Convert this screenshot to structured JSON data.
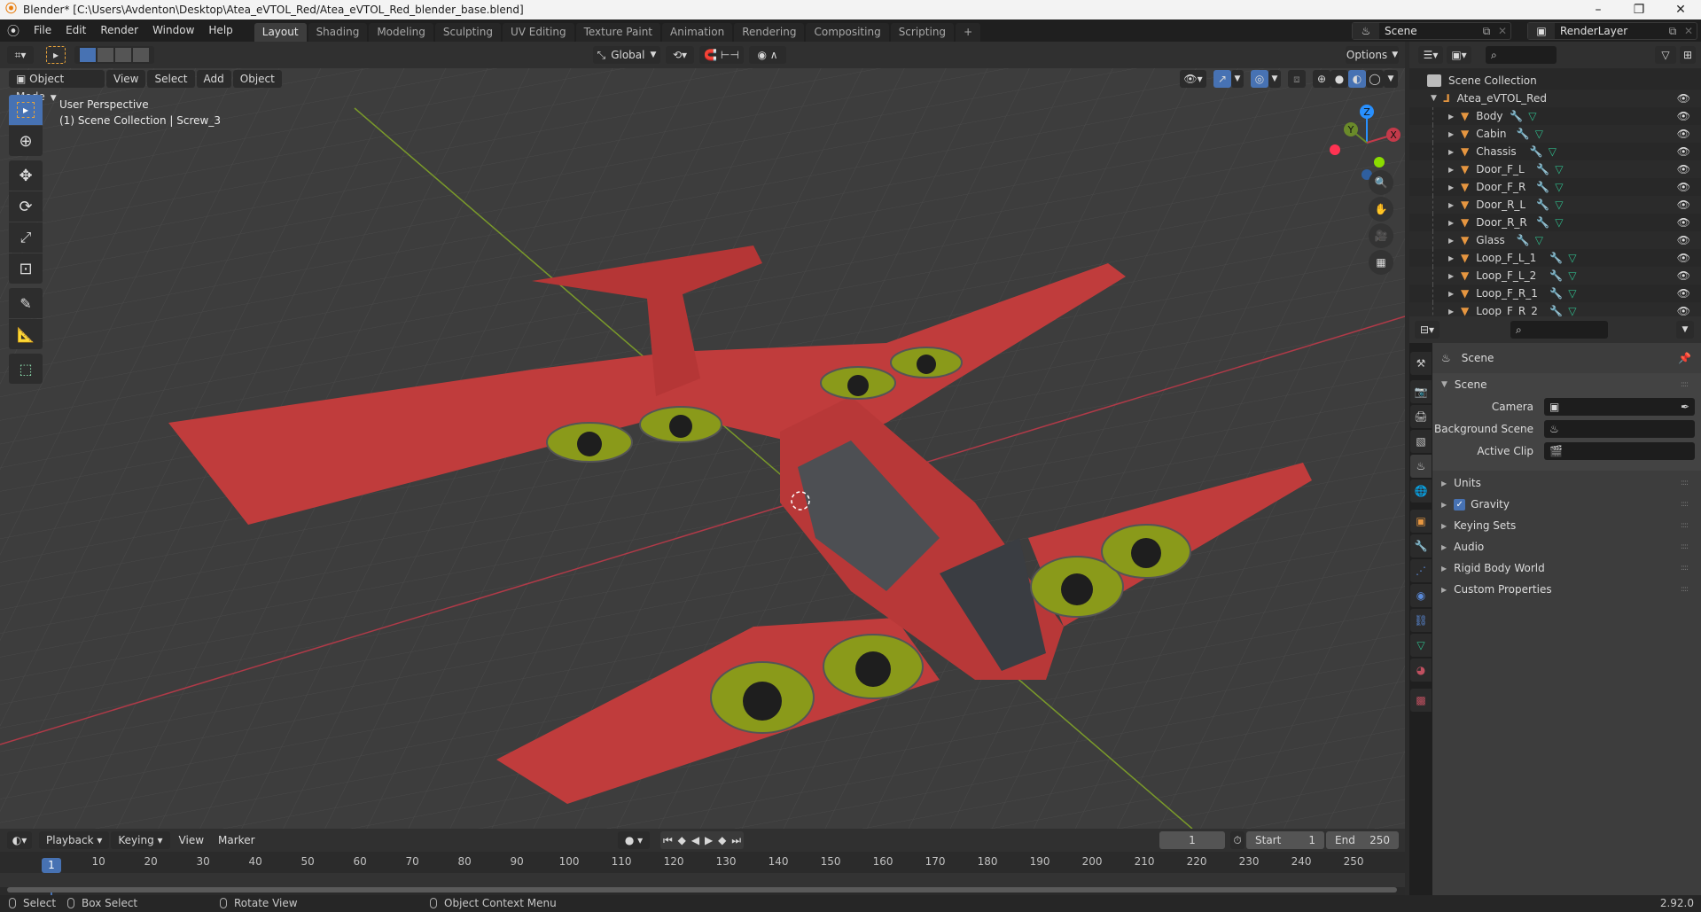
{
  "window": {
    "title": "Blender* [C:\\Users\\Avdenton\\Desktop\\Atea_eVTOL_Red/Atea_eVTOL_Red_blender_base.blend]",
    "controls": [
      "minimize",
      "maximize",
      "close"
    ]
  },
  "topbar": {
    "menus": [
      "File",
      "Edit",
      "Render",
      "Window",
      "Help"
    ],
    "workspaces": [
      "Layout",
      "Shading",
      "Modeling",
      "Sculpting",
      "UV Editing",
      "Texture Paint",
      "Animation",
      "Rendering",
      "Compositing",
      "Scripting"
    ],
    "active_workspace": "Layout",
    "add_workspace": "+",
    "scene": "Scene",
    "view_layer": "RenderLayer"
  },
  "viewport": {
    "header": {
      "transform_orientation": "Global",
      "options_label": "Options"
    },
    "mode_row": {
      "mode": "Object Mode",
      "menus": [
        "View",
        "Select",
        "Add",
        "Object"
      ]
    },
    "overlay_text": {
      "line1": "User Perspective",
      "line2": "(1) Scene Collection | Screw_3"
    },
    "gizmo_axes": {
      "x": "X",
      "y": "Y",
      "z": "Z"
    },
    "colors": {
      "x_axis": "#ff3352",
      "y_axis": "#8bdc00",
      "z_axis": "#2890ff",
      "model_body": "#c43c3c",
      "grid_bg": "#3d3d3d",
      "accent": "#4772b3"
    }
  },
  "outliner": {
    "root": "Scene Collection",
    "collection": "Atea_eVTOL_Red",
    "objects": [
      "Body",
      "Cabin",
      "Chassis",
      "Door_F_L",
      "Door_F_R",
      "Door_R_L",
      "Door_R_R",
      "Glass",
      "Loop_F_L_1",
      "Loop_F_L_2",
      "Loop_F_R_1",
      "Loop_F_R_2"
    ]
  },
  "properties": {
    "context_title": "Scene",
    "panel_title": "Scene",
    "fields": [
      {
        "label": "Camera",
        "value": ""
      },
      {
        "label": "Background Scene",
        "value": ""
      },
      {
        "label": "Active Clip",
        "value": ""
      }
    ],
    "subpanels": [
      "Units",
      "Gravity",
      "Keying Sets",
      "Audio",
      "Rigid Body World",
      "Custom Properties"
    ],
    "gravity_checked": true
  },
  "timeline": {
    "menus": [
      "Playback",
      "Keying",
      "View",
      "Marker"
    ],
    "current_frame": "1",
    "start_label": "Start",
    "start": "1",
    "end_label": "End",
    "end": "250",
    "ruler_ticks": [
      "1",
      "10",
      "20",
      "30",
      "40",
      "50",
      "60",
      "70",
      "80",
      "90",
      "100",
      "110",
      "120",
      "130",
      "140",
      "150",
      "160",
      "170",
      "180",
      "190",
      "200",
      "210",
      "220",
      "230",
      "240",
      "250"
    ]
  },
  "statusbar": {
    "items": [
      "Select",
      "Box Select",
      "Rotate View",
      "Object Context Menu"
    ],
    "version": "2.92.0"
  }
}
